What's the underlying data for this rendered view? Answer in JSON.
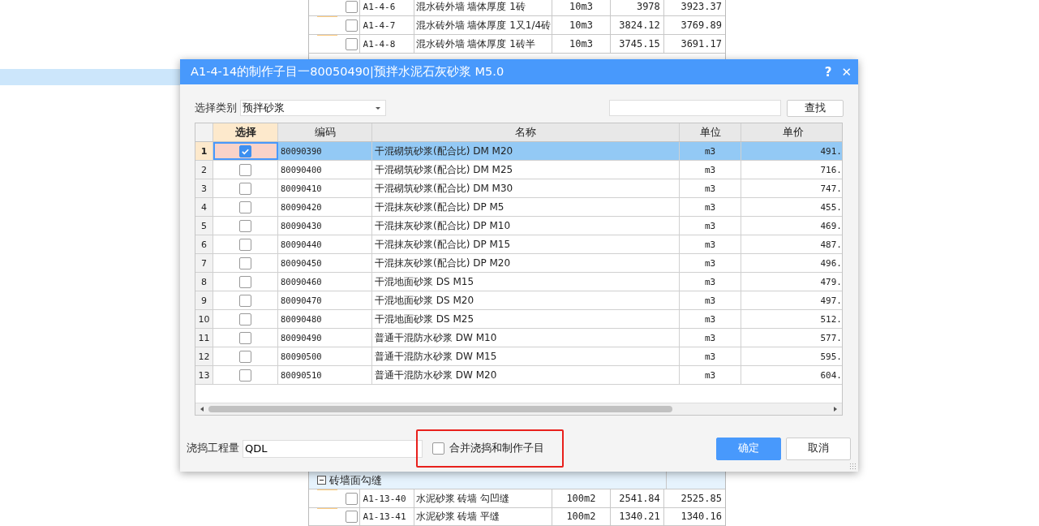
{
  "background_table": {
    "top_rows": [
      {
        "code": "A1-4-6",
        "name": "混水砖外墙 墙体厚度 1砖",
        "unit": "10m3",
        "price_1": "3978",
        "price_2": "3923.37",
        "checked": false
      },
      {
        "code": "A1-4-7",
        "name": "混水砖外墙 墙体厚度 1又1/4砖",
        "unit": "10m3",
        "price_1": "3824.12",
        "price_2": "3769.89",
        "checked": false
      },
      {
        "code": "A1-4-8",
        "name": "混水砖外墙 墙体厚度 1砖半",
        "unit": "10m3",
        "price_1": "3745.15",
        "price_2": "3691.17",
        "checked": false
      }
    ],
    "group": {
      "label": "砖墙面勾缝",
      "expanded": true
    },
    "bottom_rows": [
      {
        "code": "A1-13-40",
        "name": "水泥砂浆 砖墙 勾凹缝",
        "unit": "100m2",
        "price_1": "2541.84",
        "price_2": "2525.85",
        "checked": false
      },
      {
        "code": "A1-13-41",
        "name": "水泥砂浆 砖墙 平缝",
        "unit": "100m2",
        "price_1": "1340.21",
        "price_2": "1340.16",
        "checked": false
      }
    ]
  },
  "dialog": {
    "title": "A1-4-14的制作子目一80050490|预拌水泥石灰砂浆 M5.0",
    "help": "?",
    "close": "✕",
    "category_label": "选择类别",
    "category_value": "预拌砂浆",
    "search_button": "查找",
    "table": {
      "columns": [
        "选择",
        "编码",
        "名称",
        "单位",
        "单价"
      ],
      "rows": [
        {
          "index": "1",
          "checked": true,
          "selected": true,
          "code": "80090390",
          "name": "干混砌筑砂浆(配合比) DM M20",
          "unit": "m3",
          "price": "491."
        },
        {
          "index": "2",
          "checked": false,
          "selected": false,
          "code": "80090400",
          "name": "干混砌筑砂浆(配合比) DM M25",
          "unit": "m3",
          "price": "716."
        },
        {
          "index": "3",
          "checked": false,
          "selected": false,
          "code": "80090410",
          "name": "干混砌筑砂浆(配合比) DM M30",
          "unit": "m3",
          "price": "747."
        },
        {
          "index": "4",
          "checked": false,
          "selected": false,
          "code": "80090420",
          "name": "干混抹灰砂浆(配合比) DP M5",
          "unit": "m3",
          "price": "455."
        },
        {
          "index": "5",
          "checked": false,
          "selected": false,
          "code": "80090430",
          "name": "干混抹灰砂浆(配合比) DP M10",
          "unit": "m3",
          "price": "469."
        },
        {
          "index": "6",
          "checked": false,
          "selected": false,
          "code": "80090440",
          "name": "干混抹灰砂浆(配合比) DP M15",
          "unit": "m3",
          "price": "487."
        },
        {
          "index": "7",
          "checked": false,
          "selected": false,
          "code": "80090450",
          "name": "干混抹灰砂浆(配合比) DP M20",
          "unit": "m3",
          "price": "496."
        },
        {
          "index": "8",
          "checked": false,
          "selected": false,
          "code": "80090460",
          "name": "干混地面砂浆 DS M15",
          "unit": "m3",
          "price": "479."
        },
        {
          "index": "9",
          "checked": false,
          "selected": false,
          "code": "80090470",
          "name": "干混地面砂浆 DS M20",
          "unit": "m3",
          "price": "497."
        },
        {
          "index": "10",
          "checked": false,
          "selected": false,
          "code": "80090480",
          "name": "干混地面砂浆 DS M25",
          "unit": "m3",
          "price": "512."
        },
        {
          "index": "11",
          "checked": false,
          "selected": false,
          "code": "80090490",
          "name": "普通干混防水砂浆 DW M10",
          "unit": "m3",
          "price": "577."
        },
        {
          "index": "12",
          "checked": false,
          "selected": false,
          "code": "80090500",
          "name": "普通干混防水砂浆 DW M15",
          "unit": "m3",
          "price": "595."
        },
        {
          "index": "13",
          "checked": false,
          "selected": false,
          "code": "80090510",
          "name": "普通干混防水砂浆 DW M20",
          "unit": "m3",
          "price": "604."
        }
      ]
    },
    "quantity_label": "浇捣工程量",
    "quantity_value": "QDL",
    "merge_option": {
      "label": "合并浇捣和制作子目",
      "checked": false,
      "highlighted": true
    },
    "buttons": [
      {
        "label": "确定",
        "kind": "primary"
      },
      {
        "label": "取消",
        "kind": "secondary"
      }
    ]
  }
}
